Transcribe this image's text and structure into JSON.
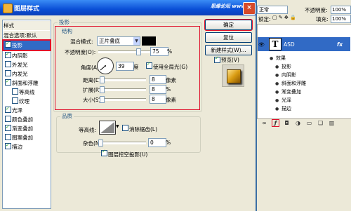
{
  "dialog": {
    "title": "图层样式",
    "watermark": "思缘论坛 www.missyuan.com",
    "close": "×"
  },
  "style_list": [
    {
      "label": "样式",
      "checkbox": false,
      "checked": false,
      "type": "header"
    },
    {
      "label": "混合选项:默认",
      "checkbox": false,
      "checked": false,
      "type": "header"
    },
    {
      "label": "投影",
      "checkbox": true,
      "checked": true,
      "type": "selected"
    },
    {
      "label": "内阴影",
      "checkbox": true,
      "checked": true
    },
    {
      "label": "外发光",
      "checkbox": true,
      "checked": false
    },
    {
      "label": "内发光",
      "checkbox": true,
      "checked": false
    },
    {
      "label": "斜面和浮雕",
      "checkbox": true,
      "checked": true
    },
    {
      "label": "等高线",
      "checkbox": true,
      "checked": false,
      "indent": true
    },
    {
      "label": "纹理",
      "checkbox": true,
      "checked": false,
      "indent": true
    },
    {
      "label": "光泽",
      "checkbox": true,
      "checked": true
    },
    {
      "label": "颜色叠加",
      "checkbox": true,
      "checked": false
    },
    {
      "label": "渐变叠加",
      "checkbox": true,
      "checked": true
    },
    {
      "label": "图案叠加",
      "checkbox": true,
      "checked": false
    },
    {
      "label": "描边",
      "checkbox": true,
      "checked": true
    }
  ],
  "shadow": {
    "section_title": "投影",
    "structure_title": "结构",
    "blend_mode_label": "混合模式:",
    "blend_mode_value": "正片叠底",
    "opacity_label": "不透明度(O):",
    "opacity_value": "75",
    "opacity_unit": "%",
    "opacity_pct": 75,
    "angle_label": "角度(A):",
    "angle_value": "39",
    "angle_unit": "度",
    "global_light_label": "使用全局光(G)",
    "global_light_checked": true,
    "distance_label": "距离(D):",
    "distance_value": "8",
    "distance_unit": "像素",
    "spread_label": "扩展(R):",
    "spread_value": "8",
    "spread_unit": "%",
    "size_label": "大小(S):",
    "size_value": "8",
    "size_unit": "像素",
    "quality_title": "品质",
    "contour_label": "等高线:",
    "antialias_label": "消除锯齿(L)",
    "noise_label": "杂色(N):",
    "noise_value": "0",
    "noise_unit": "%",
    "knockout_label": "图层挖空投影(U)",
    "knockout_checked": true,
    "shadow_color": "#000000"
  },
  "buttons": {
    "ok": "确定",
    "reset": "复位",
    "new_style": "新建样式(W)...",
    "preview": "预览(V)",
    "preview_checked": true
  },
  "layers_panel": {
    "blend_mode": "正常",
    "opacity_label": "不透明度:",
    "opacity_value": "100%",
    "lock_label": "锁定:",
    "fill_label": "填充:",
    "fill_value": "100%",
    "layer_name": "ASD",
    "thumb_letter": "T",
    "fx_badge": "fx",
    "effects_label": "效果",
    "effects": [
      "投影",
      "内阴影",
      "斜面和浮雕",
      "渐变叠加",
      "光泽",
      "描边"
    ],
    "bottom_icons": [
      "link-icon",
      "fx-icon",
      "mask-icon",
      "adjustment-icon",
      "folder-icon",
      "new-layer-icon",
      "trash-icon"
    ]
  }
}
